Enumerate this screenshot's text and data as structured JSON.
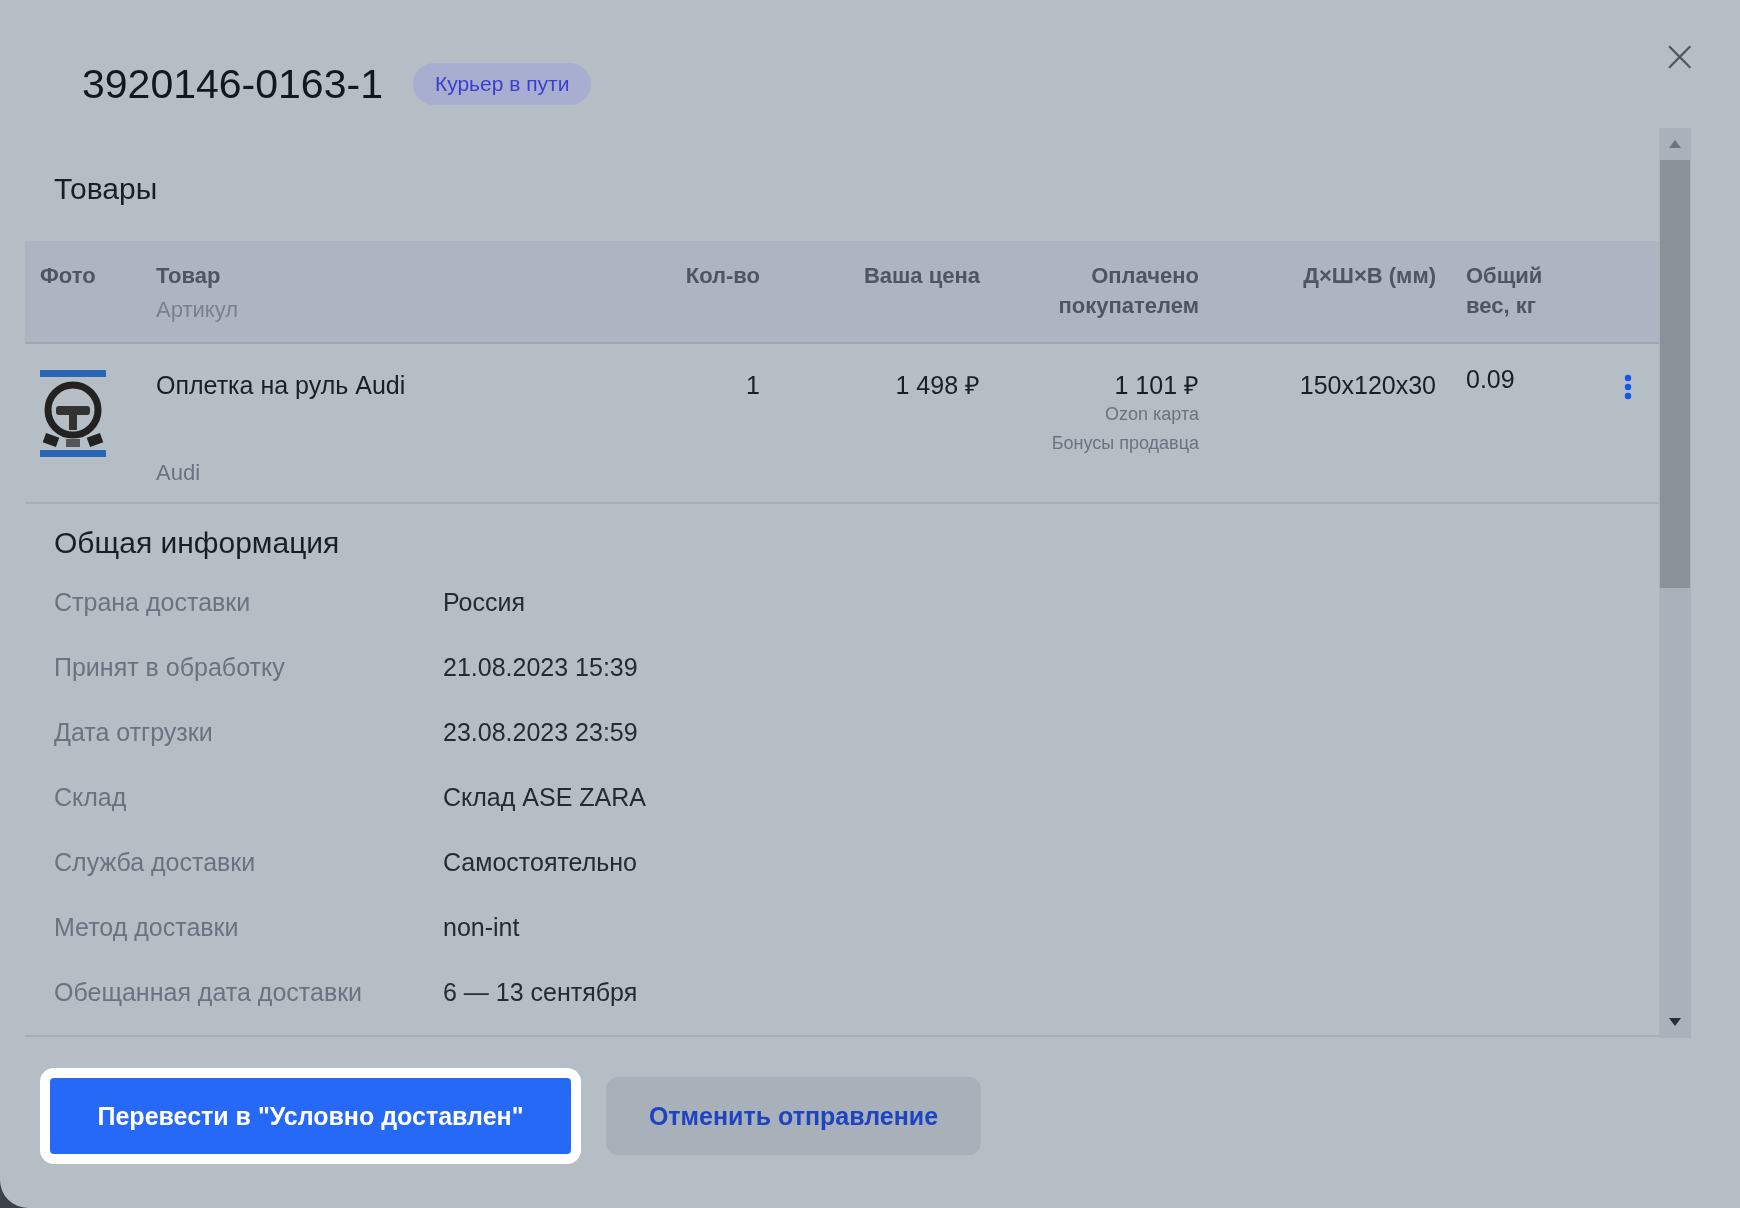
{
  "modal": {
    "title": "3920146-0163-1",
    "status_badge": "Курьер в пути",
    "close_icon": "×"
  },
  "products": {
    "title": "Товары",
    "columns": [
      {
        "label": "Фото"
      },
      {
        "label": "Товар",
        "sublabel": "Артикул"
      },
      {
        "label": "Кол-во"
      },
      {
        "label": "Ваша цена"
      },
      {
        "label": "Оплачено покупателем"
      },
      {
        "label": "Д×Ш×В (мм)"
      },
      {
        "label": "Общий вес, кг"
      }
    ],
    "rows": [
      {
        "name": "Оплетка на руль Audi",
        "article": "Audi",
        "quantity": "1",
        "your_price": "1 498 ₽",
        "paid_by_buyer": "1 101 ₽",
        "payment_notes": [
          "Ozon карта",
          "Бонусы продавца"
        ],
        "dimensions": "150x120x30",
        "weight": "0.09"
      }
    ]
  },
  "general_info": {
    "title": "Общая информация",
    "fields": [
      {
        "label": "Страна доставки",
        "value": "Россия"
      },
      {
        "label": "Принят в обработку",
        "value": "21.08.2023 15:39"
      },
      {
        "label": "Дата отгрузки",
        "value": "23.08.2023 23:59"
      },
      {
        "label": "Склад",
        "value": "Склад ASE ZARA"
      },
      {
        "label": "Служба доставки",
        "value": "Самостоятельно"
      },
      {
        "label": "Метод доставки",
        "value": "non-int"
      },
      {
        "label": "Обещанная дата доставки",
        "value": "6 — 13 сентября"
      }
    ]
  },
  "buttons": [
    {
      "label": "Перевести в \"Условно доставлен\"",
      "kind": "primary",
      "highlighted": true
    },
    {
      "label": "Отменить отправление",
      "kind": "secondary",
      "highlighted": false
    }
  ]
}
